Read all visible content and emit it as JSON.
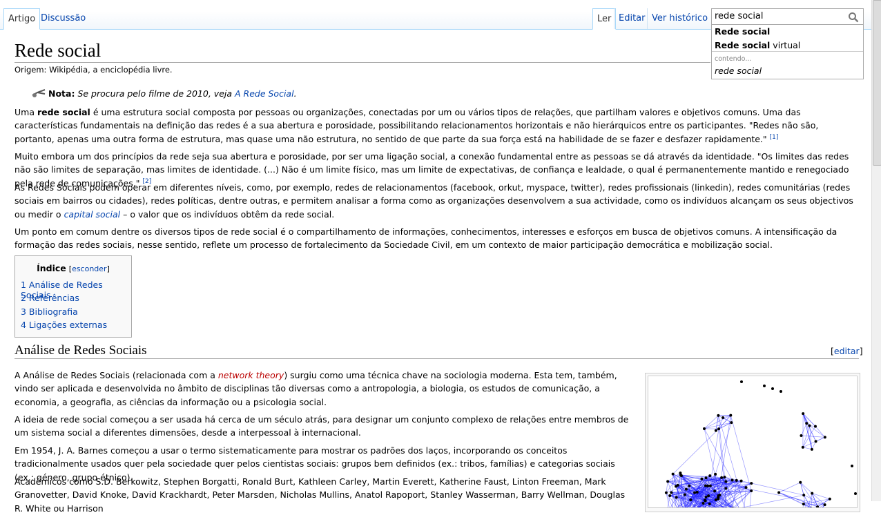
{
  "tabs": {
    "artigo": "Artigo",
    "discussao": "Discussão",
    "ler": "Ler",
    "editar": "Editar",
    "historico": "Ver histórico"
  },
  "search": {
    "value": "rede social",
    "icon": "search-icon",
    "suggestions": [
      {
        "bold": "Rede social",
        "rest": ""
      },
      {
        "bold": "Rede social",
        "rest": " virtual"
      }
    ],
    "containing_label": "contendo...",
    "containing_query": "rede social"
  },
  "page": {
    "title": "Rede social",
    "site_sub": "Origem: Wikipédia, a enciclopédia livre.",
    "note": {
      "label": "Nota:",
      "text": "Se procura pelo filme de 2010, veja ",
      "link": "A Rede Social",
      "end": "."
    },
    "p1": {
      "a": "Uma ",
      "b": "rede social",
      "c": " é uma estrutura social composta por pessoas ou organizações, conectadas por um ou vários tipos de relações, que partilham valores e objetivos comuns. Uma das características fundamentais na definição das redes é a sua abertura e porosidade, possibilitando relacionamentos horizontais e não hierárquicos entre os participantes. \"Redes não são, portanto, apenas uma outra forma de estrutura, mas quase uma não estrutura, no sentido de que parte da sua força está na habilidade de se fazer e desfazer rapidamente.\" ",
      "ref": "[1]"
    },
    "p2": {
      "text": "Muito embora um dos princípios da rede seja sua abertura e porosidade, por ser uma ligação social, a conexão fundamental entre as pessoas se dá através da identidade. \"Os limites das redes não são limites de separação, mas limites de identidade. (...) Não é um limite físico, mas um limite de expectativas, de confiança e lealdade, o qual é permanentemente mantido e renegociado pela rede de comunicações.\" ",
      "ref": "[2]"
    },
    "p3": {
      "a": "As Redes Sociais podem operar em diferentes níveis, como, por exemplo, redes de relacionamentos (facebook, orkut, myspace, twitter), redes profissionais (linkedin), redes comunitárias (redes sociais em bairros ou cidades), redes políticas, dentre outras, e permitem analisar a forma como as organizações desenvolvem a sua actividade, como os indivíduos alcançam os seus objectivos ou medir o ",
      "link": "capital social",
      "b": " – o valor que os indivíduos obtêm da rede social."
    },
    "p4": "Um ponto em comum dentre os diversos tipos de rede social é o compartilhamento de informações, conhecimentos, interesses e esforços em busca de objetivos comuns. A intensificação da formação das redes sociais, nesse sentido, reflete um processo de fortalecimento da Sociedade Civil, em um contexto de maior participação democrática e mobilização social.",
    "toc": {
      "title": "Índice",
      "hide": "esconder",
      "items": [
        "1 Análise de Redes Sociais",
        "2 Referências",
        "3 Bibliografia",
        "4 Ligações externas"
      ]
    },
    "section": {
      "heading": "Análise de Redes Sociais",
      "edit": "editar"
    },
    "s1": {
      "a": "A Análise de Redes Sociais (relacionada com a ",
      "link": "network theory",
      "b": ") surgiu como uma técnica chave na sociologia moderna. Esta tem, também, vindo ser aplicada e desenvolvida no âmbito de disciplinas tão diversas como a antropologia, a biologia, os estudos de comunicação, a economia, a geografia, as ciências da informação ou a psicologia social."
    },
    "s2": "A ideia de rede social começou a ser usada há cerca de um século atrás, para designar um conjunto complexo de relações entre membros de um sistema social a diferentes dimensões, desde a interpessoal à internacional.",
    "s3": "Em 1954, J. A. Barnes começou a usar o termo sistematicamente para mostrar os padrões dos laços, incorporando os conceitos tradicionalmente usados quer pela sociedade quer pelos cientistas sociais: grupos bem definidos (ex.: tribos, famílias) e categorias sociais (ex.: género, grupo étnico).",
    "s4": "Académicos como S.D. Berkowitz, Stephen Borgatti, Ronald Burt, Kathleen Carley, Martin Everett, Katherine Faust, Linton Freeman, Mark Granovetter, David Knoke, David Krackhardt, Peter Marsden, Nicholas Mullins, Anatol Rapoport, Stanley Wasserman, Barry Wellman, Douglas R. White ou Harrison"
  },
  "colors": {
    "link": "#0645ad",
    "redlink": "#ba0000",
    "tab_border": "#a7d7f9",
    "graph": "#1a1aff"
  }
}
